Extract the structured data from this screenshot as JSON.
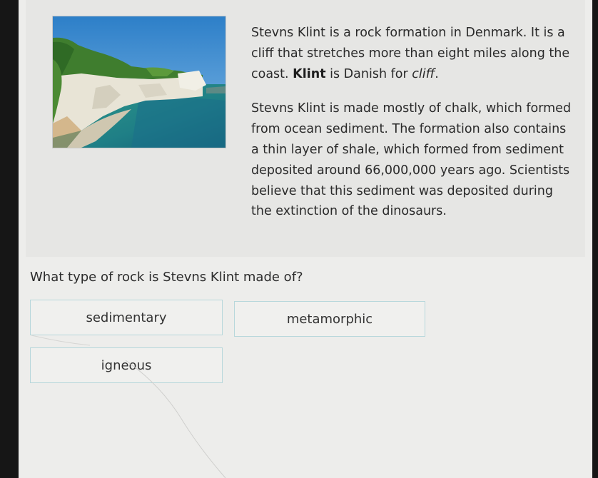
{
  "passage": {
    "p1_a": "Stevns Klint is a rock formation in Denmark. It is a cliff that stretches more than eight miles along the coast. ",
    "p1_bold": "Klint",
    "p1_b": " is Danish for ",
    "p1_italic": "cliff",
    "p1_c": ".",
    "p2": "Stevns Klint is made mostly of chalk, which formed from ocean sediment. The formation also contains a thin layer of shale, which formed from sediment deposited around 66,000,000 years ago. Scientists believe that this sediment was deposited during the extinction of the dinosaurs."
  },
  "question": {
    "text": "What type of rock is Stevns Klint made of?",
    "choices": [
      "sedimentary",
      "metamorphic",
      "igneous"
    ]
  }
}
